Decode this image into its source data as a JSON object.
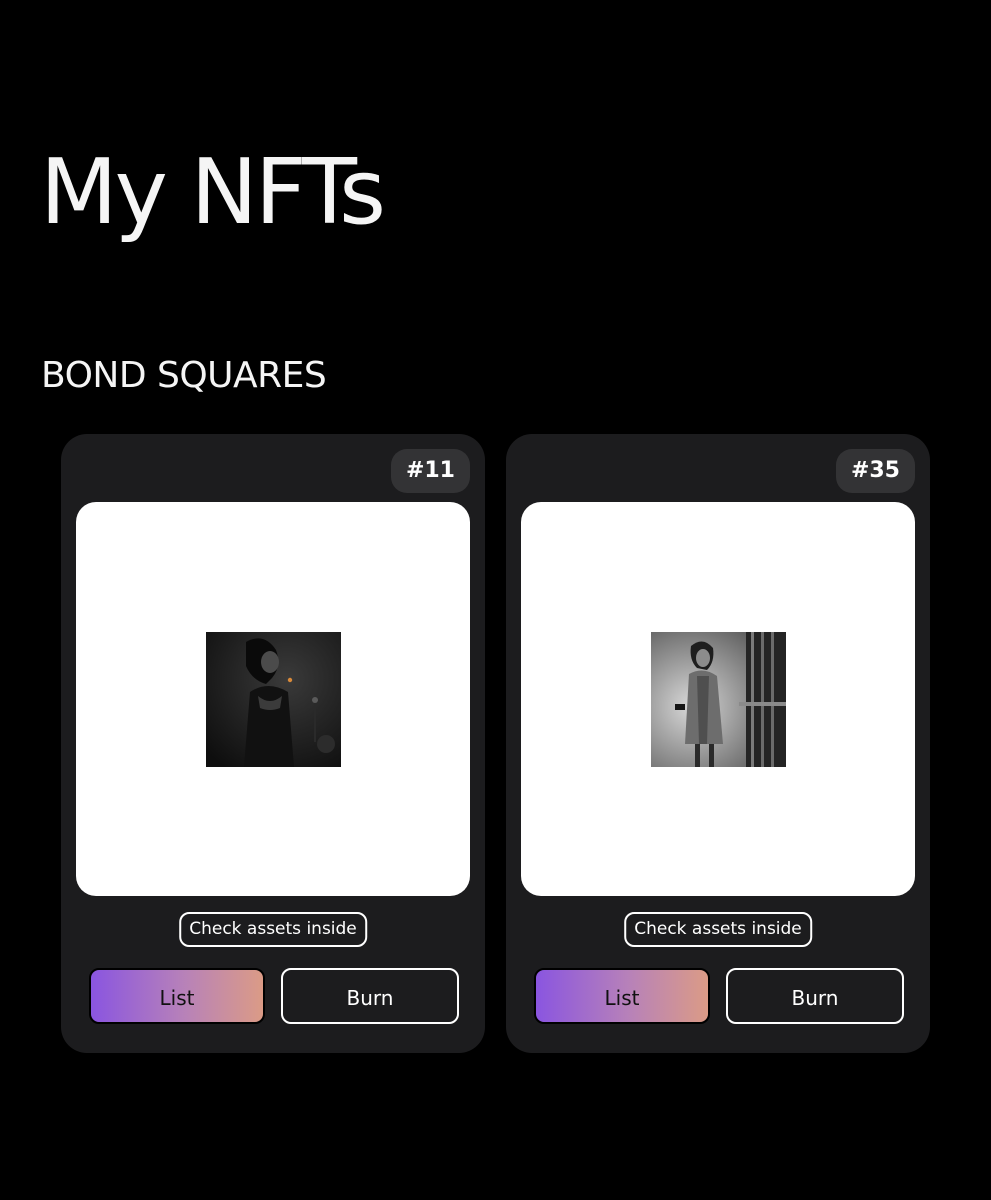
{
  "page": {
    "title": "My NFTs"
  },
  "collection": {
    "name": "BOND SQUARES"
  },
  "nfts": [
    {
      "token_id": "#11",
      "check_label": "Check assets inside",
      "list_label": "List",
      "burn_label": "Burn"
    },
    {
      "token_id": "#35",
      "check_label": "Check assets inside",
      "list_label": "List",
      "burn_label": "Burn"
    }
  ],
  "colors": {
    "background": "#000000",
    "card": "#1c1c1e",
    "badge": "#333335",
    "list_gradient_start": "#8a55e0",
    "list_gradient_end": "#db9b86"
  }
}
